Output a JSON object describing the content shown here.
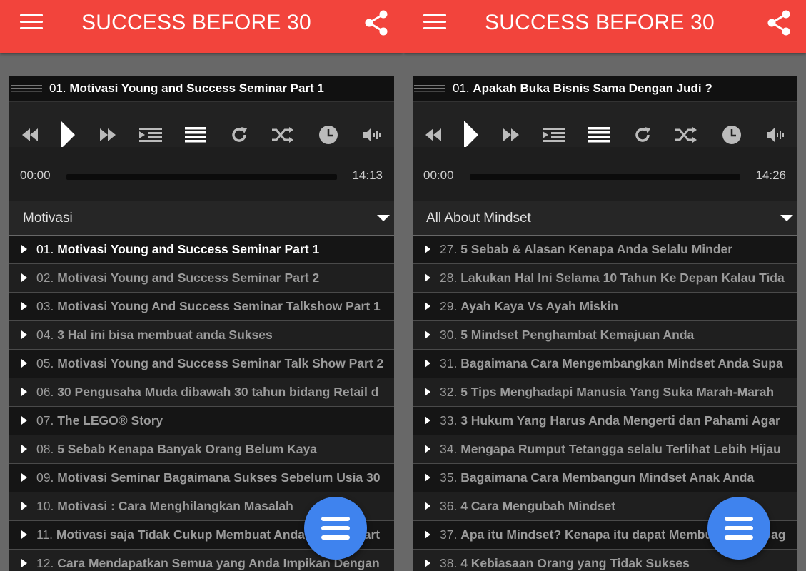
{
  "colors": {
    "appbar": "#f2443c",
    "fab": "#3f83ee",
    "seek_fill": "#4a8fea"
  },
  "icons": {
    "menu": "menu-icon",
    "share": "share-icon",
    "fab": "list-menu-icon",
    "controls": [
      "rewind-icon",
      "play-icon",
      "fast-forward-icon",
      "playlist-indent-icon",
      "list-icon",
      "repeat-icon",
      "shuffle-icon",
      "timer-icon",
      "volume-icon"
    ]
  },
  "left": {
    "appbar_title": "SUCCESS BEFORE 30",
    "now_playing": {
      "num": "01.",
      "title": "Motivasi Young and Success Seminar Part 1"
    },
    "time_current": "00:00",
    "time_total": "14:13",
    "progress": 0,
    "category": "Motivasi",
    "items": [
      {
        "num": "01.",
        "title": "Motivasi Young and Success Seminar Part 1"
      },
      {
        "num": "02.",
        "title": "Motivasi Young and Success Seminar Part 2"
      },
      {
        "num": "03.",
        "title": "Motivasi Young And Success Seminar Talkshow Part 1"
      },
      {
        "num": "04.",
        "title": "3 Hal ini bisa membuat anda Sukses"
      },
      {
        "num": "05.",
        "title": "Motivasi Young and Success Seminar Talk Show Part 2"
      },
      {
        "num": "06.",
        "title": "30 Pengusaha Muda dibawah 30 tahun bidang Retail d"
      },
      {
        "num": "07.",
        "title": "The LEGO® Story"
      },
      {
        "num": "08.",
        "title": "5 Sebab Kenapa Banyak Orang Belum Kaya"
      },
      {
        "num": "09.",
        "title": "Motivasi Seminar Bagaimana Sukses Sebelum Usia 30"
      },
      {
        "num": "10.",
        "title": "Motivasi : Cara Menghilangkan Masalah"
      },
      {
        "num": "11.",
        "title": "Motivasi saja Tidak Cukup Membuat Anda Sukses Part"
      },
      {
        "num": "12.",
        "title": "Cara Mendapatkan Semua yang Anda Impikan Dengan"
      }
    ]
  },
  "right": {
    "appbar_title": "SUCCESS BEFORE 30",
    "now_playing": {
      "num": "01.",
      "title": "Apakah Buka Bisnis Sama Dengan Judi ?"
    },
    "time_current": "00:00",
    "time_total": "14:26",
    "progress": 0,
    "category": "All About Mindset",
    "items": [
      {
        "num": "27.",
        "title": "5 Sebab & Alasan Kenapa Anda Selalu Minder"
      },
      {
        "num": "28.",
        "title": "Lakukan Hal Ini Selama 10 Tahun Ke Depan Kalau Tida"
      },
      {
        "num": "29.",
        "title": "Ayah Kaya Vs Ayah Miskin"
      },
      {
        "num": "30.",
        "title": "5 Mindset Penghambat Kemajuan Anda"
      },
      {
        "num": "31.",
        "title": "Bagaimana Cara Mengembangkan Mindset Anda Supa"
      },
      {
        "num": "32.",
        "title": "5 Tips Menghadapi Manusia Yang Suka Marah-Marah"
      },
      {
        "num": "33.",
        "title": "3 Hukum Yang Harus Anda Mengerti dan Pahami Agar"
      },
      {
        "num": "34.",
        "title": "Mengapa Rumput Tetangga selalu Terlihat Lebih Hijau"
      },
      {
        "num": "35.",
        "title": "Bagaimana Cara Membangun Mindset Anak Anda"
      },
      {
        "num": "36.",
        "title": "4 Cara Mengubah Mindset"
      },
      {
        "num": "37.",
        "title": "Apa itu Mindset? Kenapa itu dapat Membuat Anda Gag"
      },
      {
        "num": "38.",
        "title": "4 Kebiasaan Orang yang Tidak Sukses"
      }
    ]
  }
}
